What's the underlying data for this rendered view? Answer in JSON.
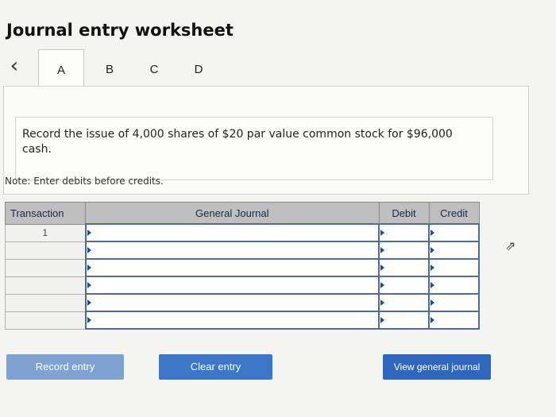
{
  "title": "Journal entry worksheet",
  "tabs": [
    "A",
    "B",
    "C",
    "D"
  ],
  "active_tab": "A",
  "nav": {
    "prev_icon": "chevron-left-icon",
    "next_icon": "chevron-right-icon"
  },
  "prompt": "Record the issue of 4,000 shares of $20 par value common stock for $96,000 cash.",
  "note": "Note: Enter debits before credits.",
  "journal": {
    "headers": {
      "transaction": "Transaction",
      "general_journal": "General Journal",
      "debit": "Debit",
      "credit": "Credit"
    },
    "rows": [
      {
        "transaction": "1",
        "account": "",
        "debit": "",
        "credit": ""
      },
      {
        "transaction": "",
        "account": "",
        "debit": "",
        "credit": ""
      },
      {
        "transaction": "",
        "account": "",
        "debit": "",
        "credit": ""
      },
      {
        "transaction": "",
        "account": "",
        "debit": "",
        "credit": ""
      },
      {
        "transaction": "",
        "account": "",
        "debit": "",
        "credit": ""
      },
      {
        "transaction": "",
        "account": "",
        "debit": "",
        "credit": ""
      }
    ]
  },
  "buttons": {
    "record": "Record entry",
    "clear": "Clear entry",
    "view": "View general journal"
  },
  "colors": {
    "button_disabled": "#7ea3d3",
    "button_primary": "#3b76c9",
    "header_bg": "#bfbfbf",
    "cell_border": "#4b6ea0"
  }
}
